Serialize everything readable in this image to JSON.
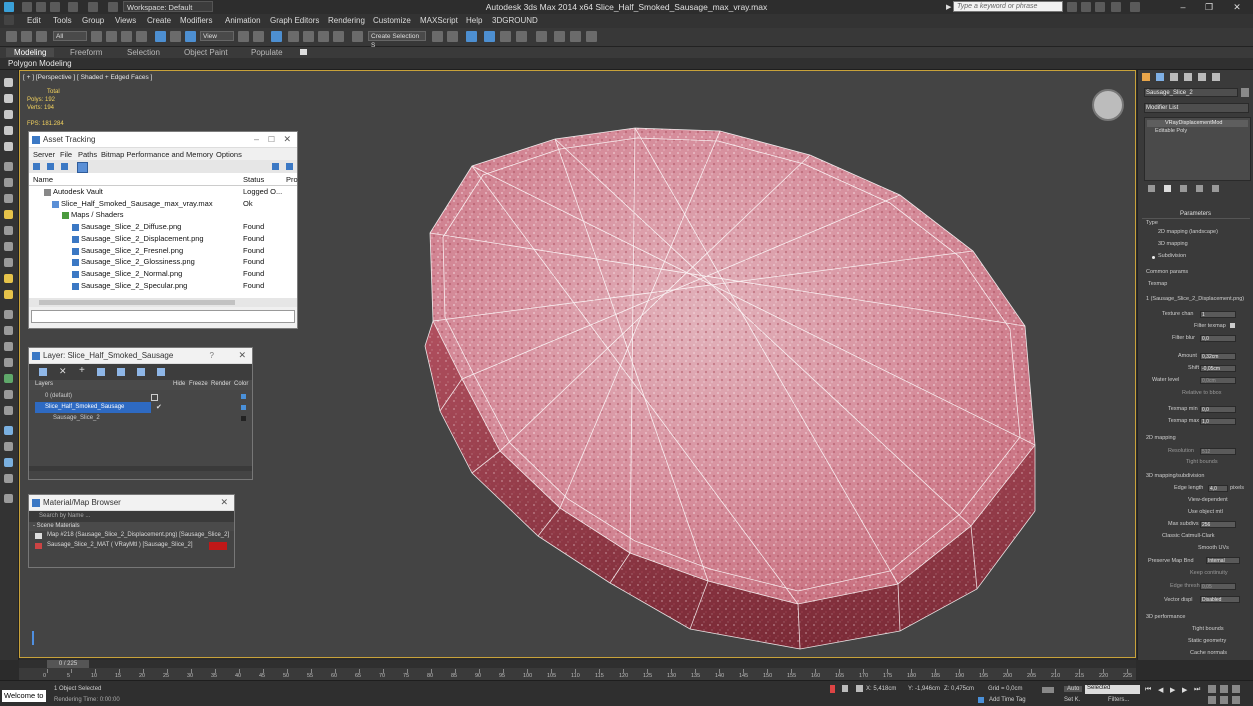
{
  "app": {
    "title": "Autodesk 3ds Max  2014 x64    Slice_Half_Smoked_Sausage_max_vray.max",
    "workspace": "Workspace: Default",
    "search_placeholder": "Type a keyword or phrase"
  },
  "menubar": [
    "Edit",
    "Tools",
    "Group",
    "Views",
    "Create",
    "Modifiers",
    "Animation",
    "Graph Editors",
    "Rendering",
    "Customize",
    "MAXScript",
    "Help",
    "3DGROUND"
  ],
  "toolbar": {
    "filter_select": "All",
    "ref_coord": "View",
    "selection_set": "Create Selection S"
  },
  "ribbon": {
    "tabs": [
      "Modeling",
      "Freeform",
      "Selection",
      "Object Paint",
      "Populate"
    ],
    "active": "Modeling",
    "sub": "Polygon Modeling"
  },
  "viewport": {
    "label": "[ + ] [Perspective ] [ Shaded + Edged Faces ]",
    "stats": {
      "total_label": "Total",
      "polys": "Polys:  192",
      "verts": "Verts:  194",
      "fps": "FPS:    181.284"
    }
  },
  "asset_tracking": {
    "title": "Asset Tracking",
    "menu": [
      "Server",
      "File",
      "Paths",
      "Bitmap Performance and Memory",
      "Options"
    ],
    "columns": [
      "Name",
      "Status",
      "Pro"
    ],
    "rows": [
      {
        "name": "Autodesk Vault",
        "status": "Logged O..."
      },
      {
        "name": "Slice_Half_Smoked_Sausage_max_vray.max",
        "status": "Ok"
      },
      {
        "name": "Maps / Shaders",
        "status": ""
      },
      {
        "name": "Sausage_Slice_2_Diffuse.png",
        "status": "Found"
      },
      {
        "name": "Sausage_Slice_2_Displacement.png",
        "status": "Found"
      },
      {
        "name": "Sausage_Slice_2_Fresnel.png",
        "status": "Found"
      },
      {
        "name": "Sausage_Slice_2_Glossiness.png",
        "status": "Found"
      },
      {
        "name": "Sausage_Slice_2_Normal.png",
        "status": "Found"
      },
      {
        "name": "Sausage_Slice_2_Specular.png",
        "status": "Found"
      }
    ]
  },
  "layer_dialog": {
    "title": "Layer: Slice_Half_Smoked_Sausage",
    "columns": [
      "Layers",
      "Hide",
      "Freeze",
      "Render",
      "Color"
    ],
    "rows": [
      "0 (default)",
      "Slice_Half_Smoked_Sausage",
      "Sausage_Slice_2"
    ]
  },
  "material_browser": {
    "title": "Material/Map Browser",
    "search": "Search by Name ...",
    "group": "- Scene Materials",
    "items": [
      "Map #218 (Sausage_Slice_2_Displacement.png) [Sausage_Slice_2]",
      "Sausage_Slice_2_MAT  ( VRayMtl ) [Sausage_Slice_2]"
    ]
  },
  "command_panel": {
    "object_name": "Sausage_Slice_2",
    "modifier_list": "Modifier List",
    "stack": [
      "VRayDisplacementMod",
      "Editable Poly"
    ],
    "parameters": "Parameters",
    "type_label": "Type",
    "types": [
      "2D mapping (landscape)",
      "3D mapping",
      "Subdivision"
    ],
    "common": "Common params",
    "texmap_label": "Texmap",
    "texmap": "1 (Sausage_Slice_2_Displacement.png)",
    "fields": [
      {
        "label": "Texture chan",
        "value": "1"
      },
      {
        "label": "Filter texmap",
        "value": ""
      },
      {
        "label": "Filter blur",
        "value": "0,0"
      },
      {
        "label": "Amount",
        "value": "0,32cm"
      },
      {
        "label": "Shift",
        "value": "-0,05cm"
      },
      {
        "label": "Water level",
        "value": "0,0cm"
      },
      {
        "label": "Relative to bbox",
        "value": ""
      },
      {
        "label": "Texmap min",
        "value": "0,0"
      },
      {
        "label": "Texmap max",
        "value": "1,0"
      }
    ],
    "sec_2d": "2D mapping",
    "resolution": {
      "label": "Resolution",
      "value": "512"
    },
    "tight_bounds": "Tight bounds",
    "sec_3d": "3D mapping/subdivision",
    "fields3d": [
      {
        "label": "Edge length",
        "value": "4,0"
      },
      {
        "label": "View-dependent",
        "value": ""
      },
      {
        "label": "Use object mtl",
        "value": ""
      },
      {
        "label": "Max subdivs",
        "value": "256"
      },
      {
        "label": "Classic Catmull-Clark",
        "value": ""
      },
      {
        "label": "Smooth UVs",
        "value": ""
      },
      {
        "label": "Preserve Map Bnd",
        "value": "Internal"
      },
      {
        "label": "Keep continuity",
        "value": ""
      },
      {
        "label": "Edge thresh",
        "value": "0,05"
      },
      {
        "label": "Vector displ",
        "value": "Disabled"
      }
    ],
    "pixels": "pixels",
    "sec_perf": "3D performance",
    "perf": [
      "Tight bounds",
      "Static geometry",
      "Cache normals"
    ]
  },
  "timeline": {
    "frame": "0 / 225",
    "ticks": [
      "0",
      "5",
      "10",
      "15",
      "20",
      "25",
      "30",
      "35",
      "40",
      "45",
      "50",
      "55",
      "60",
      "65",
      "70",
      "75",
      "80",
      "85",
      "90",
      "95",
      "100",
      "105",
      "110",
      "115",
      "120",
      "125",
      "130",
      "135",
      "140",
      "145",
      "150",
      "155",
      "160",
      "165",
      "170",
      "175",
      "180",
      "185",
      "190",
      "195",
      "200",
      "205",
      "210",
      "215",
      "220",
      "225"
    ]
  },
  "status": {
    "welcome": "Welcome to",
    "selected": "1 Object Selected",
    "render_time": "Rendering Time: 0:00:00",
    "x": "X: 5,418cm",
    "y": "Y: -1,946cm",
    "z": "Z: 0,475cm",
    "grid": "Grid = 0,0cm",
    "add_time_tag": "Add Time Tag",
    "auto": "Auto",
    "set_k": "Set K.",
    "selected_dd": "Selected",
    "filters": "Filters..."
  }
}
